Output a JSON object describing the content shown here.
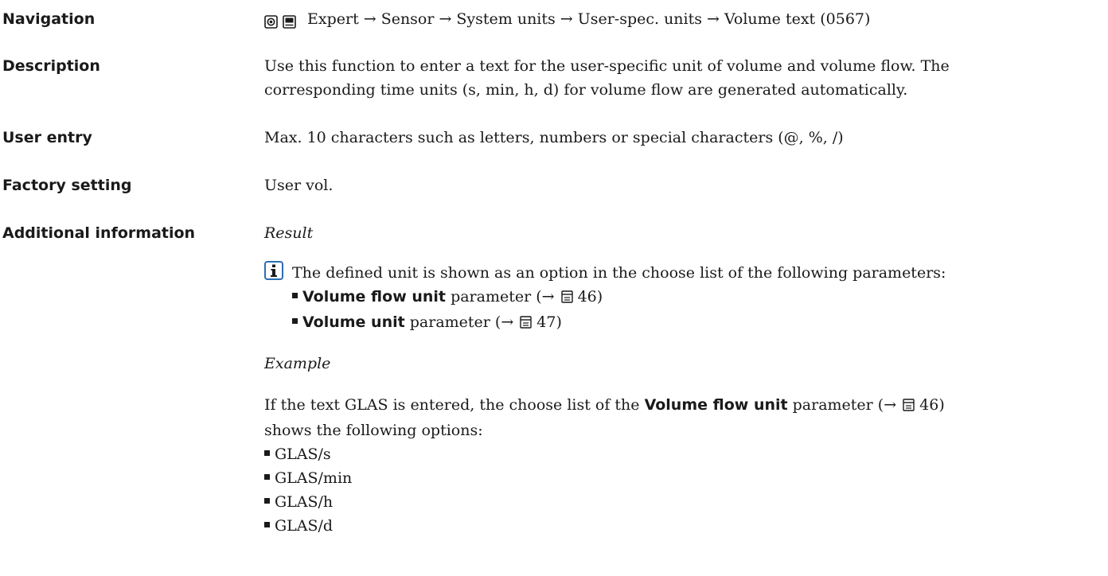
{
  "navigation": {
    "label": "Navigation",
    "path": [
      "Expert",
      "Sensor",
      "System units",
      "User-spec. units",
      "Volume text (0567)"
    ]
  },
  "description": {
    "label": "Description",
    "line1": "Use this function to enter a text for the user-specific unit of volume and volume flow. The",
    "line2": "corresponding time units (s, min, h, d) for volume flow are generated automatically."
  },
  "user_entry": {
    "label": "User entry",
    "text": "Max. 10 characters such as letters, numbers or special characters (@, %, /)"
  },
  "factory_setting": {
    "label": "Factory setting",
    "text": "User vol."
  },
  "additional": {
    "label": "Additional information",
    "result_heading": "Result",
    "note": "The defined unit is shown as an option in the choose list of the following parameters:",
    "params": [
      {
        "name": "Volume flow unit",
        "suffix": "parameter (",
        "page": "46"
      },
      {
        "name": "Volume unit",
        "suffix": "parameter (",
        "page": "47"
      }
    ],
    "example_heading": "Example",
    "example_pre": "If the text GLAS is entered, the choose list of the",
    "example_param": "Volume flow unit",
    "example_post": "parameter (",
    "example_page": "46",
    "example_line2": "shows the following options:",
    "options": [
      "GLAS/s",
      "GLAS/min",
      "GLAS/h",
      "GLAS/d"
    ]
  }
}
